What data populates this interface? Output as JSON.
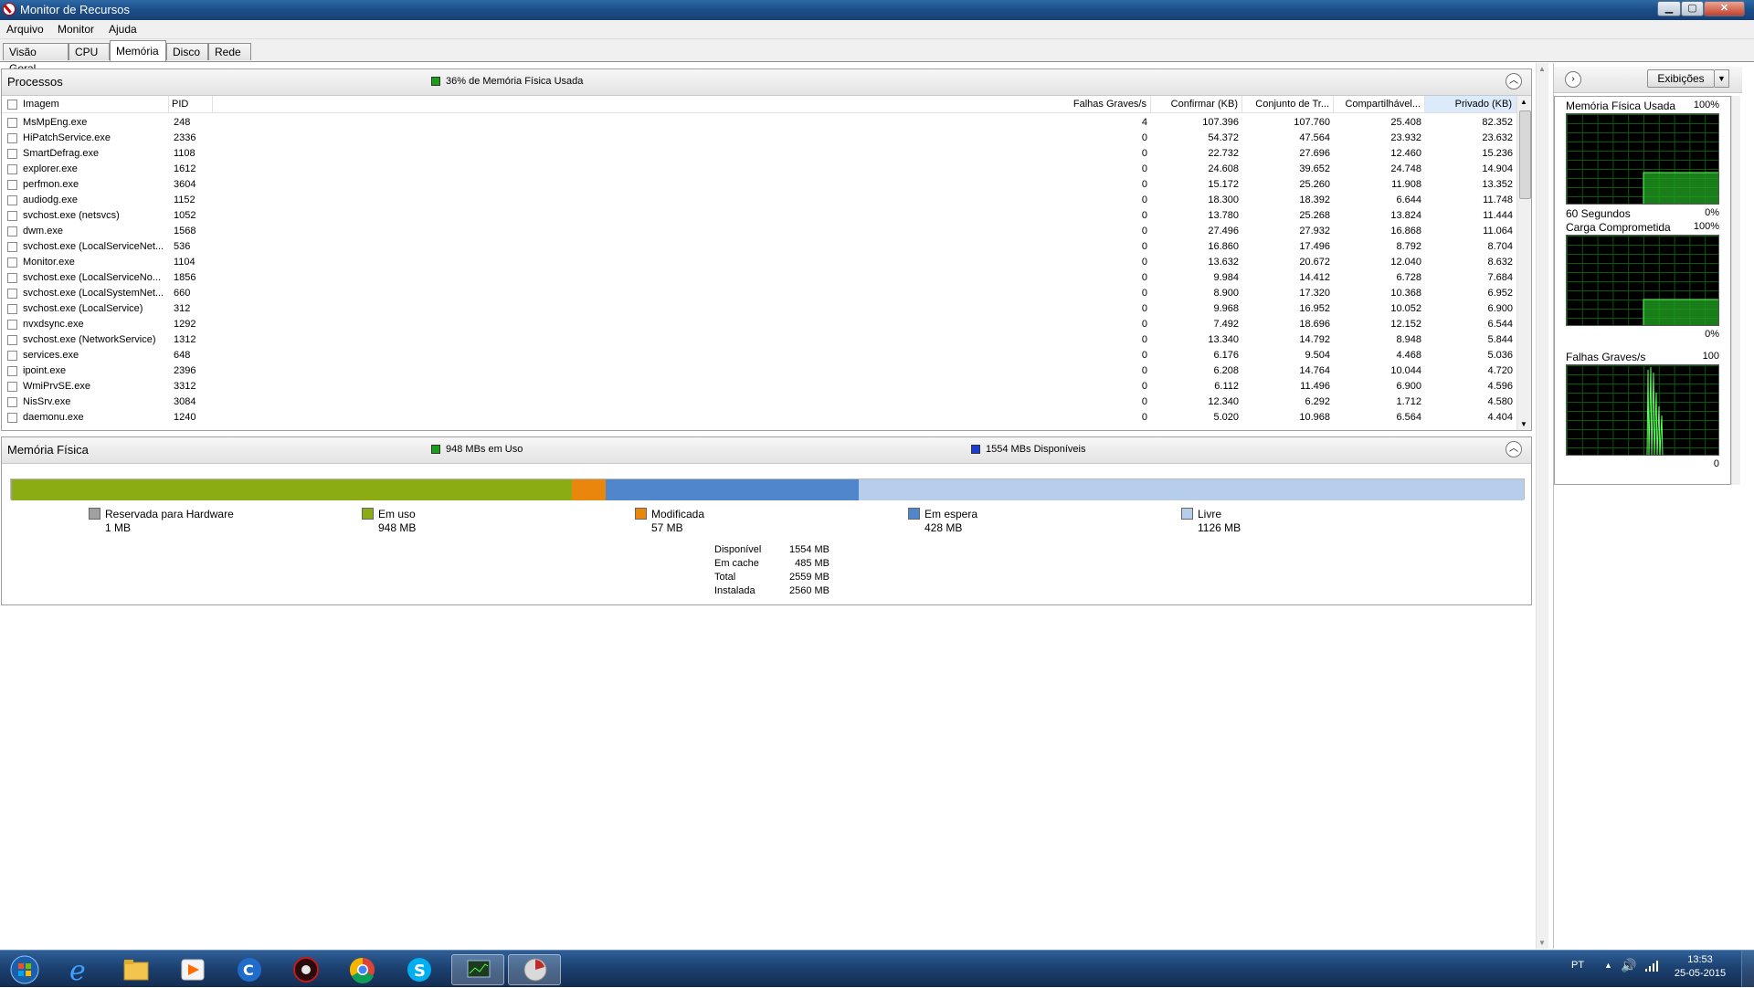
{
  "window": {
    "title": "Monitor de Recursos"
  },
  "menu": [
    "Arquivo",
    "Monitor",
    "Ajuda"
  ],
  "tabs": [
    "Visão Geral",
    "CPU",
    "Memória",
    "Disco",
    "Rede"
  ],
  "processes": {
    "title": "Processos",
    "usage_label": "36% de Memória Física Usada",
    "columns": [
      "Imagem",
      "PID",
      "Falhas Graves/s",
      "Confirmar (KB)",
      "Conjunto de Tr...",
      "Compartilhável...",
      "Privado (KB)"
    ],
    "rows": [
      [
        "MsMpEng.exe",
        "248",
        "4",
        "107.396",
        "107.760",
        "25.408",
        "82.352"
      ],
      [
        "HiPatchService.exe",
        "2336",
        "0",
        "54.372",
        "47.564",
        "23.932",
        "23.632"
      ],
      [
        "SmartDefrag.exe",
        "1108",
        "0",
        "22.732",
        "27.696",
        "12.460",
        "15.236"
      ],
      [
        "explorer.exe",
        "1612",
        "0",
        "24.608",
        "39.652",
        "24.748",
        "14.904"
      ],
      [
        "perfmon.exe",
        "3604",
        "0",
        "15.172",
        "25.260",
        "11.908",
        "13.352"
      ],
      [
        "audiodg.exe",
        "1152",
        "0",
        "18.300",
        "18.392",
        "6.644",
        "11.748"
      ],
      [
        "svchost.exe (netsvcs)",
        "1052",
        "0",
        "13.780",
        "25.268",
        "13.824",
        "11.444"
      ],
      [
        "dwm.exe",
        "1568",
        "0",
        "27.496",
        "27.932",
        "16.868",
        "11.064"
      ],
      [
        "svchost.exe (LocalServiceNet...",
        "536",
        "0",
        "16.860",
        "17.496",
        "8.792",
        "8.704"
      ],
      [
        "Monitor.exe",
        "1104",
        "0",
        "13.632",
        "20.672",
        "12.040",
        "8.632"
      ],
      [
        "svchost.exe (LocalServiceNo...",
        "1856",
        "0",
        "9.984",
        "14.412",
        "6.728",
        "7.684"
      ],
      [
        "svchost.exe (LocalSystemNet...",
        "660",
        "0",
        "8.900",
        "17.320",
        "10.368",
        "6.952"
      ],
      [
        "svchost.exe (LocalService)",
        "312",
        "0",
        "9.968",
        "16.952",
        "10.052",
        "6.900"
      ],
      [
        "nvxdsync.exe",
        "1292",
        "0",
        "7.492",
        "18.696",
        "12.152",
        "6.544"
      ],
      [
        "svchost.exe (NetworkService)",
        "1312",
        "0",
        "13.340",
        "14.792",
        "8.948",
        "5.844"
      ],
      [
        "services.exe",
        "648",
        "0",
        "6.176",
        "9.504",
        "4.468",
        "5.036"
      ],
      [
        "ipoint.exe",
        "2396",
        "0",
        "6.208",
        "14.764",
        "10.044",
        "4.720"
      ],
      [
        "WmiPrvSE.exe",
        "3312",
        "0",
        "6.112",
        "11.496",
        "6.900",
        "4.596"
      ],
      [
        "NisSrv.exe",
        "3084",
        "0",
        "12.340",
        "6.292",
        "1.712",
        "4.580"
      ],
      [
        "daemonu.exe",
        "1240",
        "0",
        "5.020",
        "10.968",
        "6.564",
        "4.404"
      ]
    ]
  },
  "physical_memory": {
    "title": "Memória Física",
    "in_use_label": "948 MBs em Uso",
    "available_label": "1554 MBs Disponíveis",
    "segments": [
      {
        "label": "Reservada para Hardware",
        "value": "1 MB",
        "mb": 1,
        "color": "#a0a0a0"
      },
      {
        "label": "Em uso",
        "value": "948 MB",
        "mb": 948,
        "color": "#8cac14"
      },
      {
        "label": "Modificada",
        "value": "57 MB",
        "mb": 57,
        "color": "#e8870b"
      },
      {
        "label": "Em espera",
        "value": "428 MB",
        "mb": 428,
        "color": "#4f86cc"
      },
      {
        "label": "Livre",
        "value": "1126 MB",
        "mb": 1126,
        "color": "#b6cdec"
      }
    ],
    "summary": [
      {
        "label": "Disponível",
        "value": "1554 MB"
      },
      {
        "label": "Em cache",
        "value": "485 MB"
      },
      {
        "label": "Total",
        "value": "2559 MB"
      },
      {
        "label": "Instalada",
        "value": "2560 MB"
      }
    ]
  },
  "side_panel": {
    "views_button": "Exibições",
    "graphs": [
      {
        "title": "Memória Física Usada",
        "max": "100%",
        "bottom_left": "60 Segundos",
        "bottom_right": "0%"
      },
      {
        "title": "Carga Comprometida",
        "max": "100%",
        "bottom_left": "",
        "bottom_right": "0%"
      },
      {
        "title": "Falhas Graves/s",
        "max": "100",
        "bottom_left": "",
        "bottom_right": "0"
      }
    ]
  },
  "taskbar": {
    "language": "PT",
    "time": "13:53",
    "date": "25-05-2015",
    "apps": [
      "start-orb-icon",
      "internet-explorer-icon",
      "file-explorer-icon",
      "media-player-icon",
      "ccleaner-icon",
      "game-app-icon",
      "chrome-icon",
      "skype-icon",
      "resource-monitor-icon",
      "defrag-icon"
    ]
  }
}
